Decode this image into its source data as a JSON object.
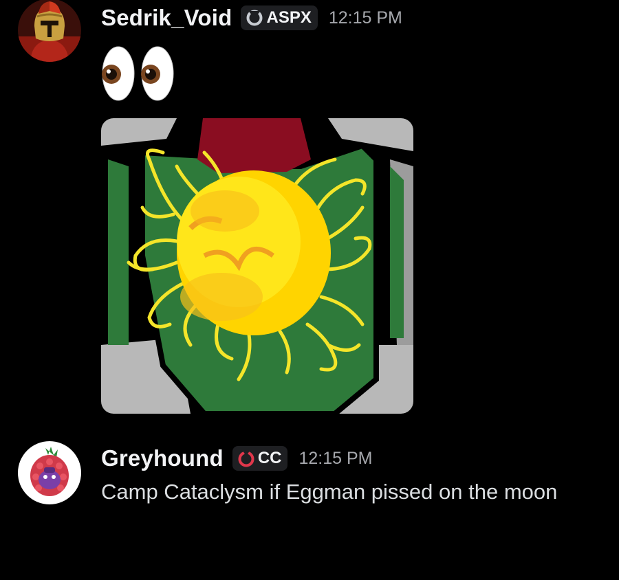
{
  "messages": [
    {
      "author": "Sedrik_Void",
      "tag": "ASPX",
      "tag_icon": "pacman-ring-icon",
      "timestamp": "12:15 PM",
      "content_emoji": "eyes-emoji",
      "attachment": "sun-tentacle-drawing"
    },
    {
      "author": "Greyhound",
      "tag": "CC",
      "tag_icon": "red-ring-icon",
      "timestamp": "12:15 PM",
      "content": "Camp Cataclysm if Eggman pissed on the moon"
    }
  ],
  "colors": {
    "background": "#000000",
    "username": "#f2f3f5",
    "timestamp": "#a6a8ad",
    "message_text": "#dbdee1",
    "tag_background": "#1e1f22"
  }
}
